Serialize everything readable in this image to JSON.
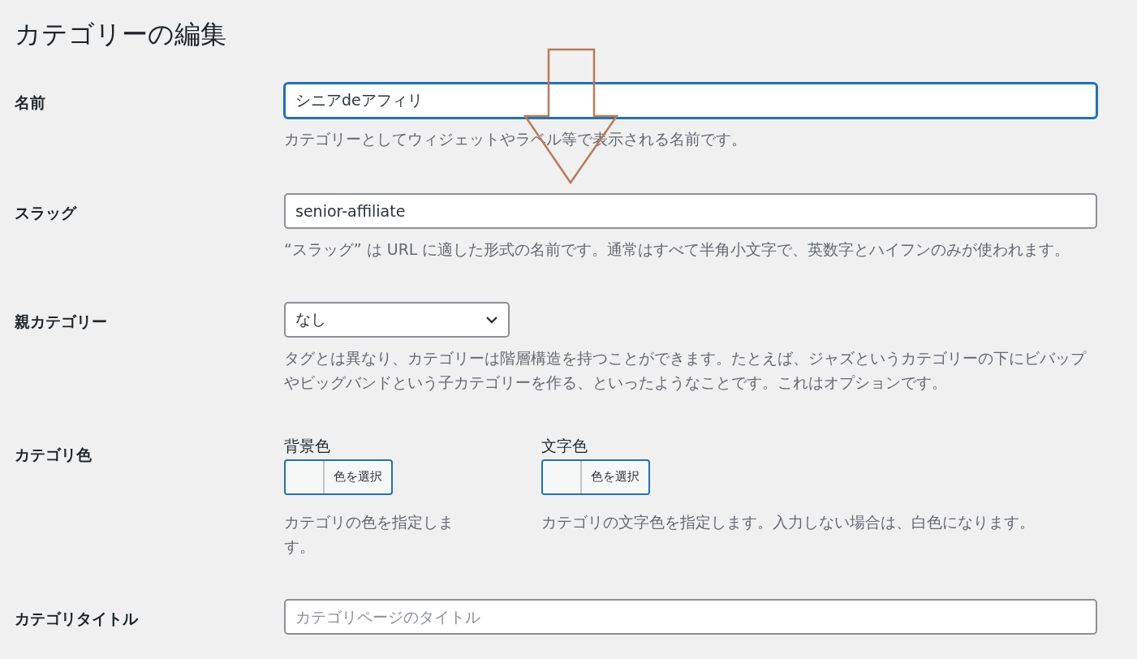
{
  "page_title": "カテゴリーの編集",
  "fields": [
    {
      "kind": "text",
      "label": "名前",
      "value": "シニアdeアフィリ",
      "focused": true,
      "description": "カテゴリーとしてウィジェットやラベル等で表示される名前です。"
    },
    {
      "kind": "text",
      "label": "スラッグ",
      "value": "senior-affiliate",
      "focused": false,
      "description": "“スラッグ” は URL に適した形式の名前です。通常はすべて半角小文字で、英数字とハイフンのみが使われます。"
    },
    {
      "kind": "select",
      "label": "親カテゴリー",
      "value": "なし",
      "description": "タグとは異なり、カテゴリーは階層構造を持つことができます。たとえば、ジャズというカテゴリーの下にビバップやビッグバンドという子カテゴリーを作る、といったようなことです。これはオプションです。"
    },
    {
      "kind": "colors",
      "label": "カテゴリ色",
      "pickers": [
        {
          "label": "背景色",
          "button": "色を選択",
          "description": "カテゴリの色を指定します。"
        },
        {
          "label": "文字色",
          "button": "色を選択",
          "description": "カテゴリの文字色を指定します。入力しない場合は、白色になります。"
        }
      ]
    },
    {
      "kind": "text",
      "label": "カテゴリタイトル",
      "placeholder": "カテゴリページのタイトル",
      "focused": false
    }
  ]
}
